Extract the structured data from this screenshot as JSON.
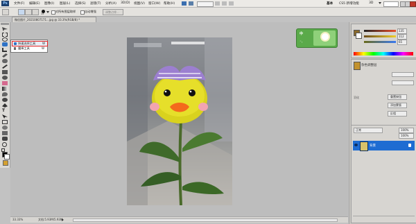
{
  "menubar": {
    "app_logo": "Ps",
    "items": [
      "文件(F)",
      "编辑(E)",
      "图像(I)",
      "图层(L)",
      "选择(S)",
      "滤镜(T)",
      "分析(A)",
      "3D(D)",
      "视图(V)",
      "窗口(W)",
      "帮助(H)"
    ],
    "workspace": {
      "basic": "基本",
      "cs5_new": "CS5 新增功能",
      "mode": "3D"
    }
  },
  "options_bar": {
    "brush_size": "15",
    "sample_all_layers": "对所有图层取样",
    "auto_enhance": "自动增强",
    "refine_edge": "调整边缘..."
  },
  "document": {
    "tab_title": "微信图片_20210807171...jpg @ 33.3%(RGB/8) *"
  },
  "flyout": {
    "quick_selection": "快速选择工具",
    "quick_selection_key": "W",
    "magic_wand": "魔棒工具",
    "magic_wand_key": "W"
  },
  "ime": {
    "lang": "中",
    "punct": "◦,"
  },
  "status": {
    "zoom": "33.33%",
    "doc_size": "文档:5.93M/5.93M"
  },
  "color_panel": {
    "values": [
      "135",
      "112",
      "65"
    ],
    "accent": "#d68b2a"
  },
  "adjustments_panel": {
    "title": "杂色调整层",
    "buttons": [
      "重置按钮",
      "添加蒙版",
      "反相"
    ],
    "side_label": "羽化"
  },
  "layers_panel": {
    "blend_mode": "正常",
    "opacity": "100%",
    "fill": "100%",
    "layer_name": "背景",
    "selected_color": "#1e6cd2"
  },
  "colors": {
    "foreground": "#000000",
    "background": "#ffffff",
    "accent_red": "#e02020",
    "highlight": "#2478e0"
  }
}
